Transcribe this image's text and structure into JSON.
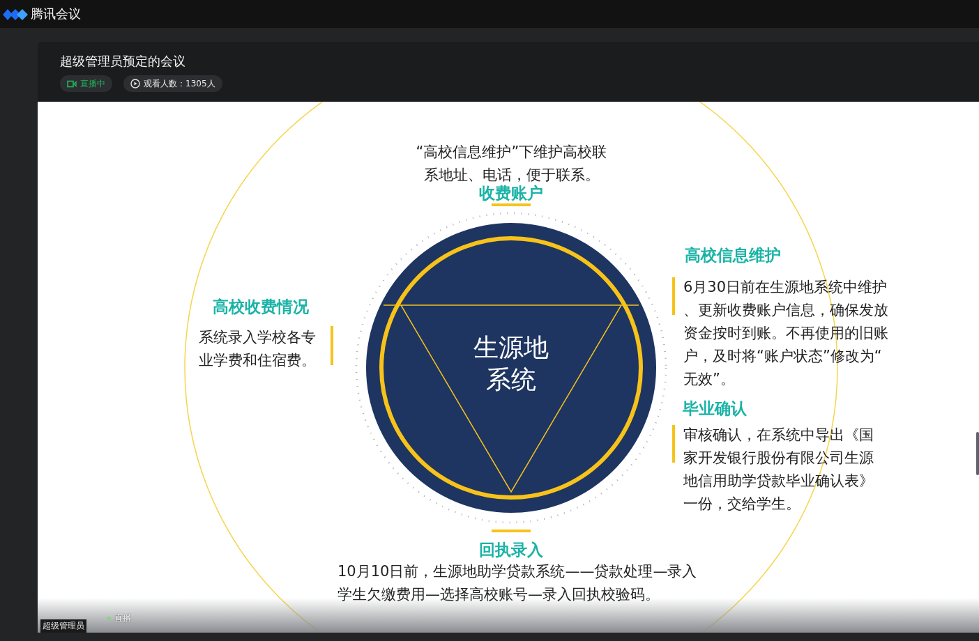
{
  "app": {
    "name": "腾讯会议"
  },
  "meeting": {
    "title": "超级管理员预定的会议",
    "badges": [
      {
        "kind": "live",
        "label": "直播中"
      },
      {
        "kind": "viewers",
        "label": "观看人数：1305人"
      }
    ]
  },
  "slide": {
    "center_lines": [
      "生源地",
      "系统"
    ],
    "sections": [
      {
        "kind": "top",
        "heading": "收费账户",
        "body": "“高校信息维护”下维护高校联系地址、电话，便于联系。"
      },
      {
        "kind": "left",
        "heading": "高校收费情况",
        "body": "系统录入学校各专业学费和住宿费。"
      },
      {
        "kind": "right-upper",
        "heading": "高校信息维护",
        "body": "6月30日前在生源地系统中维护、更新收费账户信息，确保发放资金按时到账。不再使用的旧账户，及时将“账户状态”修改为“无效”。"
      },
      {
        "kind": "right-lower",
        "heading": "毕业确认",
        "body": "审核确认，在系统中导出《国家开发银行股份有限公司生源地信用助学贷款毕业确认表》一份，交给学生。"
      },
      {
        "kind": "bottom",
        "heading": "回执录入",
        "body": "10月10日前，生源地助学贷款系统——贷款处理—录入学生欠缴费用—选择高校账号—录入回执校验码。"
      }
    ]
  },
  "player": {
    "status": "直播",
    "presenter": "超级管理员"
  }
}
